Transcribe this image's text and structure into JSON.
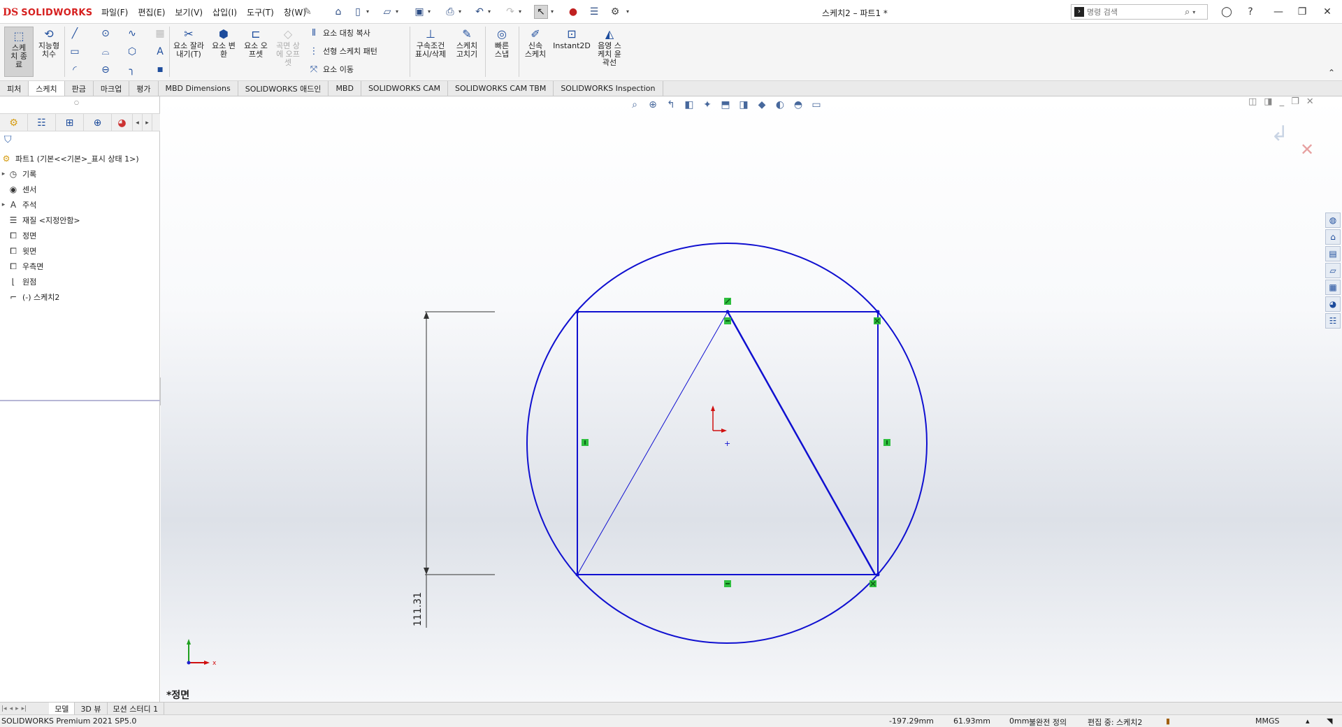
{
  "app": {
    "brand": "SOLIDWORKS",
    "doc_title": "스케치2 – 파트1 *",
    "menu": [
      "파일(F)",
      "편집(E)",
      "보기(V)",
      "삽입(I)",
      "도구(T)",
      "창(W)"
    ],
    "search_placeholder": "명령 검색"
  },
  "toolbar": {
    "sketch_exit": "스케치 종료",
    "smart_dim": "지능형 치수",
    "trim": "요소 잘라내기(T)",
    "convert": "요소 변환",
    "offset": "요소 오프셋",
    "offset_surface": "곡면 상에 오프셋",
    "mirror": "요소 대칭 복사",
    "linear_pattern": "선형 스케치 패턴",
    "move": "요소 이동",
    "relations": "구속조건 표시/삭제",
    "repair": "스케치 고치기",
    "quick_snap": "빠른 스냅",
    "rapid_sketch": "신속 스케치",
    "instant2d": "Instant2D",
    "shaded": "음영 스케치 윤곽선"
  },
  "tabs": [
    "피처",
    "스케치",
    "판금",
    "마크업",
    "평가",
    "MBD Dimensions",
    "SOLIDWORKS 애드인",
    "MBD",
    "SOLIDWORKS CAM",
    "SOLIDWORKS CAM TBM",
    "SOLIDWORKS Inspection"
  ],
  "active_tab": "스케치",
  "tree": {
    "root": "파트1  (기본<<기본>_표시 상태 1>)",
    "items": [
      {
        "label": "기록",
        "icon": "history-icon",
        "expandable": true
      },
      {
        "label": "센서",
        "icon": "sensor-icon",
        "expandable": false
      },
      {
        "label": "주석",
        "icon": "annotation-icon",
        "expandable": true
      },
      {
        "label": "재질 <지정안함>",
        "icon": "material-icon",
        "expandable": false
      },
      {
        "label": "정면",
        "icon": "plane-icon",
        "expandable": false
      },
      {
        "label": "윗면",
        "icon": "plane-icon",
        "expandable": false
      },
      {
        "label": "우측면",
        "icon": "plane-icon",
        "expandable": false
      },
      {
        "label": "원점",
        "icon": "origin-icon",
        "expandable": false
      },
      {
        "label": "(-) 스케치2",
        "icon": "sketch-icon",
        "expandable": false
      }
    ]
  },
  "viewport": {
    "view_name": "*정면",
    "dimension": "111.31",
    "triad_x": "x",
    "sketch_color": "#1010d0",
    "relation_color": "#2fbf3f"
  },
  "bottom_tabs": [
    "모델",
    "3D 뷰",
    "모션 스터디 1"
  ],
  "status": {
    "product": "SOLIDWORKS Premium 2021 SP5.0",
    "x": "-197.29mm",
    "y": "61.93mm",
    "z": "0mm",
    "state": "불완전 정의",
    "editing": "편집 중: 스케치2",
    "units": "MMGS"
  }
}
